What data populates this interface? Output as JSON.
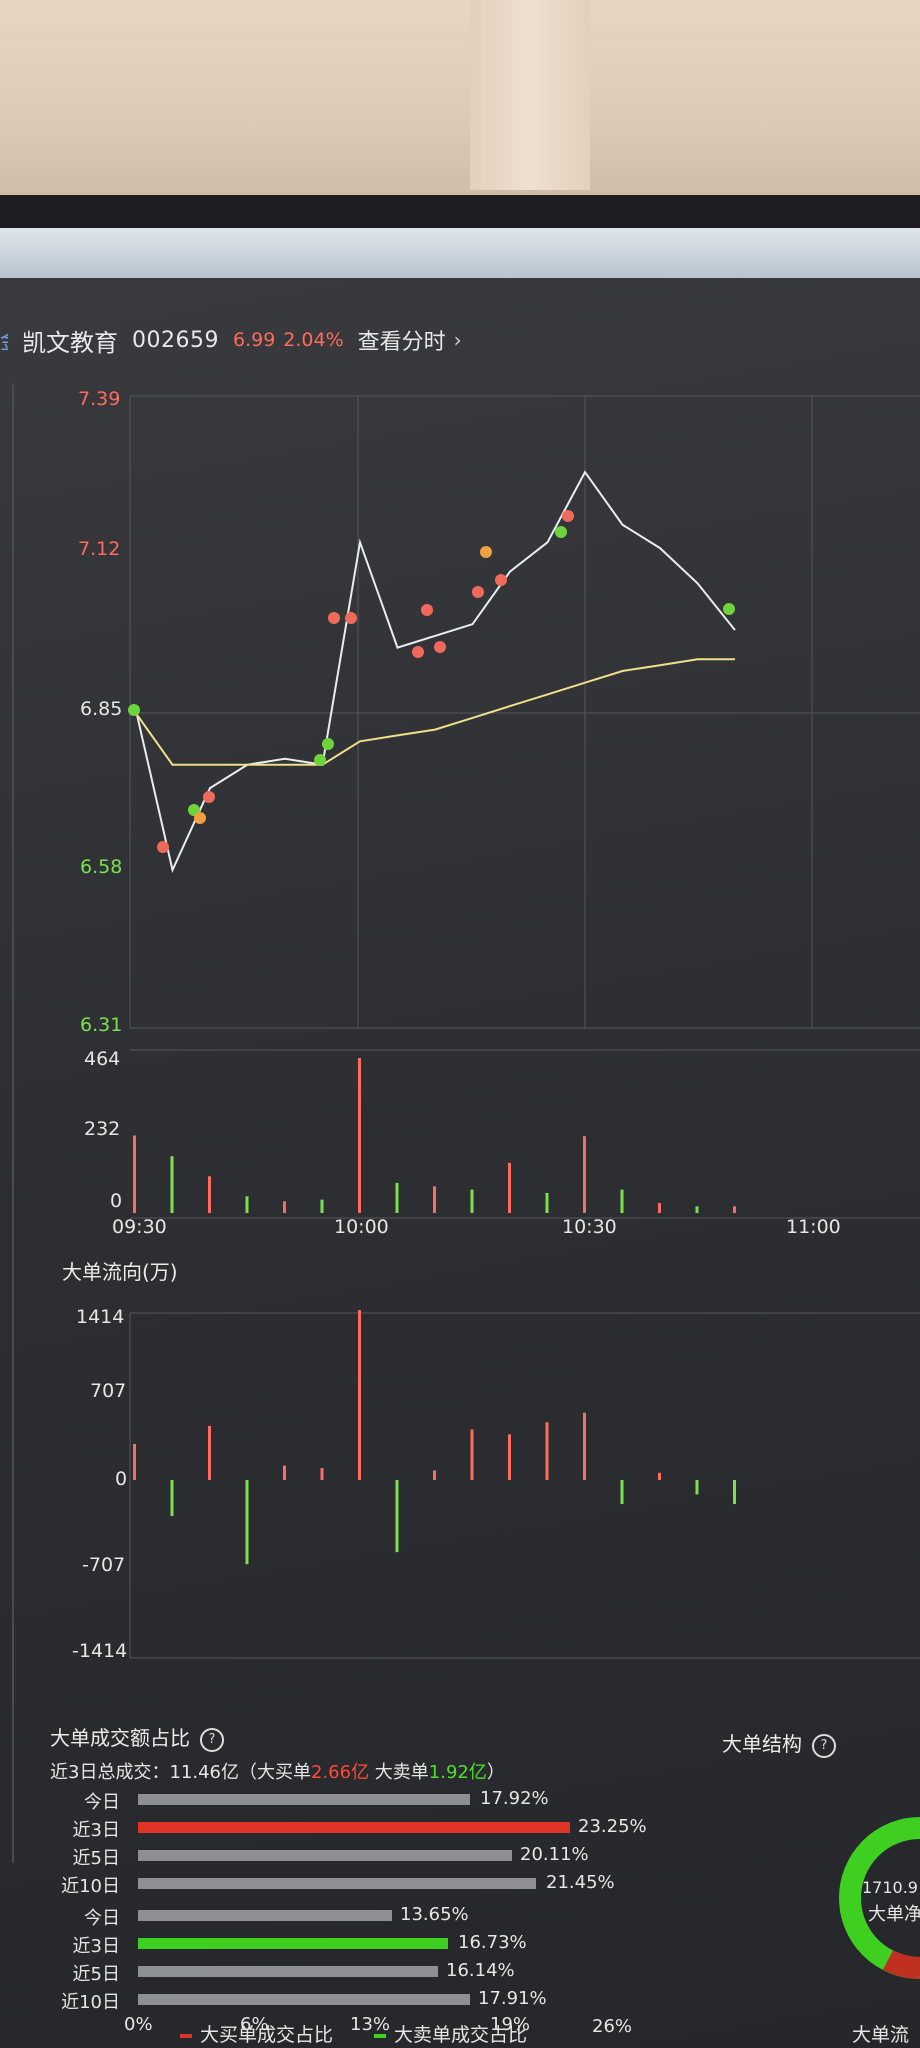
{
  "header": {
    "prev_char": "金",
    "stock_name": "凯文教育",
    "stock_code": "002659",
    "price": "6.99",
    "change_pct": "2.04%",
    "view_link": "查看分时",
    "chevron": "›"
  },
  "price_axis": {
    "labels": [
      "7.39",
      "7.12",
      "6.85",
      "6.58",
      "6.31"
    ]
  },
  "volume_axis": {
    "labels": [
      "464",
      "232",
      "0"
    ]
  },
  "time_axis": {
    "labels": [
      "09:30",
      "10:00",
      "10:30",
      "11:00"
    ]
  },
  "flow": {
    "title": "大单流向(万)",
    "labels": [
      "1414",
      "707",
      "0",
      "-707",
      "-1414"
    ]
  },
  "ratio": {
    "title": "大单成交额占比",
    "help": "?",
    "summary_prefix": "近3日总成交：11.46亿（大买单",
    "buy_amount": "2.66亿",
    "summary_mid": " 大卖单",
    "sell_amount": "1.92亿",
    "summary_suffix": "）",
    "buy_rows": [
      {
        "label": "今日",
        "value": "17.92%"
      },
      {
        "label": "近3日",
        "value": "23.25%"
      },
      {
        "label": "近5日",
        "value": "20.11%"
      },
      {
        "label": "近10日",
        "value": "21.45%"
      }
    ],
    "sell_rows": [
      {
        "label": "今日",
        "value": "13.65%"
      },
      {
        "label": "近3日",
        "value": "16.73%"
      },
      {
        "label": "近5日",
        "value": "16.14%"
      },
      {
        "label": "近10日",
        "value": "17.91%"
      }
    ],
    "x_ticks": [
      "0%",
      "6%",
      "13%",
      "19%",
      "26%"
    ],
    "legend_buy": "大买单成交占比",
    "legend_sell": "大卖单成交占比"
  },
  "structure": {
    "title": "大单结构",
    "help": "?",
    "donut_value": "1710.9",
    "donut_label": "大单净",
    "bottom_label": "大单流"
  },
  "colors": {
    "up": "#ff6b5e",
    "down": "#7ae04e",
    "avg_line": "#f0e08a",
    "price_line": "#e8eef0"
  },
  "chart_data": [
    {
      "type": "line",
      "title": "",
      "x": [
        "09:30",
        "09:35",
        "09:40",
        "09:45",
        "09:50",
        "09:55",
        "10:00",
        "10:05",
        "10:10",
        "10:15",
        "10:20",
        "10:25",
        "10:30",
        "10:35",
        "10:40",
        "10:45",
        "10:50"
      ],
      "series": [
        {
          "values": [
            6.86,
            6.58,
            6.72,
            6.76,
            6.77,
            6.76,
            7.14,
            6.96,
            6.98,
            7.0,
            7.09,
            7.14,
            7.26,
            7.17,
            7.13,
            7.07,
            6.99
          ]
        },
        {
          "values": [
            6.85,
            6.76,
            6.76,
            6.76,
            6.76,
            6.76,
            6.8,
            6.81,
            6.82,
            6.84,
            6.86,
            6.88,
            6.9,
            6.92,
            6.93,
            6.94,
            6.94
          ]
        }
      ],
      "ylim": [
        6.31,
        7.39
      ]
    },
    {
      "type": "bar",
      "title": "",
      "categories": [
        "09:30",
        "09:35",
        "09:40",
        "09:45",
        "09:50",
        "09:55",
        "10:00",
        "10:05",
        "10:10",
        "10:15",
        "10:20",
        "10:25",
        "10:30",
        "10:35",
        "10:40",
        "10:45",
        "10:50"
      ],
      "values": [
        232,
        170,
        110,
        50,
        35,
        40,
        464,
        90,
        80,
        70,
        150,
        60,
        230,
        70,
        30,
        20,
        20
      ],
      "ylim": [
        0,
        464
      ]
    },
    {
      "type": "bar",
      "title": "大单流向(万)",
      "categories": [
        "09:30",
        "09:35",
        "09:40",
        "09:45",
        "09:50",
        "09:55",
        "10:00",
        "10:05",
        "10:10",
        "10:15",
        "10:20",
        "10:25",
        "10:30",
        "10:35",
        "10:40",
        "10:45",
        "10:50"
      ],
      "values": [
        300,
        -300,
        450,
        -700,
        120,
        100,
        1414,
        -600,
        80,
        420,
        380,
        480,
        560,
        -200,
        60,
        -120,
        -200
      ],
      "ylim": [
        -1414,
        1414
      ]
    },
    {
      "type": "bar",
      "title": "大单成交额占比",
      "categories": [
        "今日",
        "近3日",
        "近5日",
        "近10日"
      ],
      "series": [
        {
          "name": "大买单成交占比",
          "values": [
            17.92,
            23.25,
            20.11,
            21.45
          ]
        },
        {
          "name": "大卖单成交占比",
          "values": [
            13.65,
            16.73,
            16.14,
            17.91
          ]
        }
      ],
      "xlim": [
        0,
        26
      ]
    }
  ]
}
